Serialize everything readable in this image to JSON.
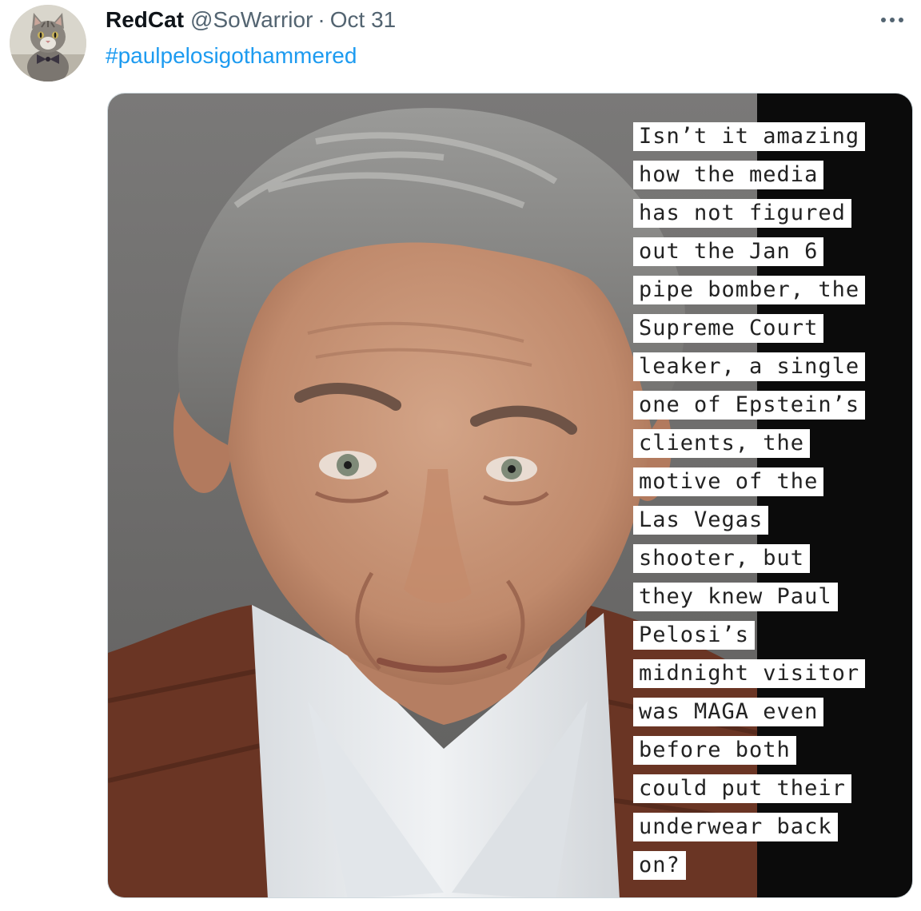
{
  "tweet": {
    "author": {
      "display_name": "RedCat",
      "handle": "@SoWarrior",
      "avatar_icon": "cat-avatar-icon"
    },
    "separator": "·",
    "date": "Oct 31",
    "more_icon": "more-options-icon",
    "hashtag": "#paulpelosigothammered",
    "media": {
      "photo": "portrait-photo",
      "caption_lines": [
        "Isn’t it amazing",
        "how the media",
        "has not figured",
        "out the Jan 6",
        "pipe bomber, the",
        "Supreme Court",
        "leaker, a single",
        "one of Epstein’s",
        "clients, the",
        "motive of the",
        "Las Vegas",
        "shooter, but",
        "they knew Paul",
        "Pelosi’s",
        "midnight visitor",
        "was MAGA even",
        "before both",
        "could put their",
        "underwear back",
        "on?"
      ]
    }
  },
  "colors": {
    "link": "#1d9bf0",
    "secondary_text": "#536471",
    "primary_text": "#0f1419",
    "photo_background": "#6f6e6c",
    "right_band": "#0b0b0b",
    "jacket": "#6a3524",
    "shirt": "#e6e8ea",
    "skin": "#c59478",
    "hair": "#8c8c8c"
  }
}
